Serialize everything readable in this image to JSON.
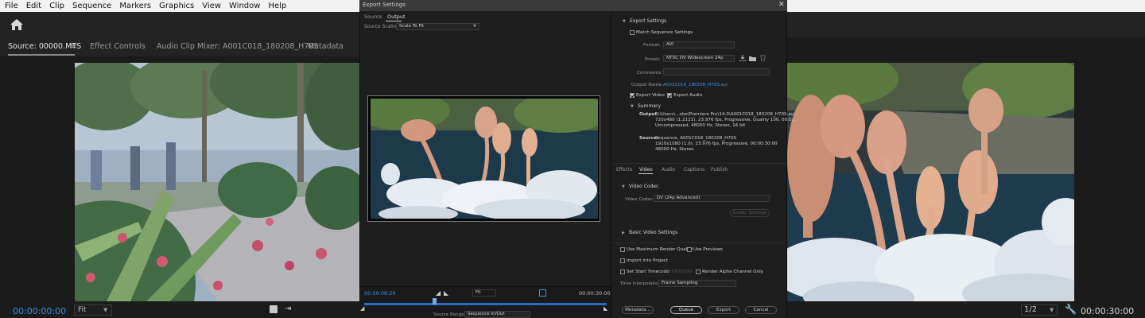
{
  "menu": [
    "File",
    "Edit",
    "Clip",
    "Sequence",
    "Markers",
    "Graphics",
    "View",
    "Window",
    "Help"
  ],
  "source_panel": {
    "tabs": [
      "Source: 00000.MTS",
      "Effect Controls",
      "Audio Clip Mixer: A001C018_180208_H70S",
      "Metadata"
    ],
    "menu_glyph": "≡",
    "timecode": "00:00:00:00",
    "fit": "Fit"
  },
  "program_panel": {
    "zoom": "1/2",
    "timecode": "00:00:30:00"
  },
  "dialog": {
    "title": "Export Settings",
    "close": "✕",
    "tabs": [
      "Source",
      "Output"
    ],
    "source_scaling_label": "Source Scaling:",
    "source_scaling_value": "Scale To Fit",
    "timeline": {
      "tc_in": "00:00:08:20",
      "tc_out": "00:00:30:00",
      "fit": "Fit",
      "source_range_label": "Source Range:",
      "source_range_value": "Sequence In/Out"
    },
    "export_settings": {
      "header": "Export Settings",
      "match_sequence": "Match Sequence Settings",
      "format_label": "Format:",
      "format_value": "AVI",
      "preset_label": "Preset:",
      "preset_value": "NTSC DV Widescreen 24p",
      "comments_label": "Comments:",
      "output_name_label": "Output Name:",
      "output_name_value": "A001C018_180208_H70S.avi",
      "export_video": "Export Video",
      "export_audio": "Export Audio"
    },
    "summary": {
      "header": "Summary",
      "output_label": "Output:",
      "output_lines": [
        "C:\\Users\\...obe\\Premiere Pro\\14.0\\A001C018_180208_H70S.avi",
        "720x480 (1.2121), 23.976 fps, Progressive, Quality 100, 00:0...",
        "Uncompressed, 48000 Hz, Stereo, 16 bit"
      ],
      "source_label": "Source:",
      "source_lines": [
        "Sequence, A001C018_180208_H70S",
        "1920x1080 (1.0), 23.976 fps, Progressive, 00:00:30:00",
        "48000 Hz, Stereo"
      ]
    },
    "settings_tabs": [
      "Effects",
      "Video",
      "Audio",
      "Captions",
      "Publish"
    ],
    "video_codec": {
      "header": "Video Codec",
      "label": "Video Codec:",
      "value": "DV (24p Advanced)",
      "codec_settings_button": "Codec Settings"
    },
    "basic_video_settings": "Basic Video Settings",
    "options": {
      "max_render_quality": "Use Maximum Render Quality",
      "use_previews": "Use Previews",
      "import_into_project": "Import Into Project",
      "set_start_timecode": "Set Start Timecode",
      "start_timecode_value": "00:00:00:00",
      "render_alpha": "Render Alpha Channel Only",
      "time_interpolation_label": "Time Interpolation:",
      "time_interpolation_value": "Frame Sampling"
    },
    "buttons": {
      "metadata": "Metadata...",
      "queue": "Queue",
      "export": "Export",
      "cancel": "Cancel"
    }
  },
  "colors": {
    "accent_blue": "#3c8fe0",
    "panel_bg": "#1d1d1d",
    "menu_bg": "#f2f2f2"
  },
  "icons": [
    "home-icon",
    "panel-menu-icon",
    "close-icon",
    "wrench-icon",
    "mark-in-icon",
    "mark-out-icon",
    "save-preset-icon",
    "import-preset-icon",
    "delete-preset-icon"
  ]
}
